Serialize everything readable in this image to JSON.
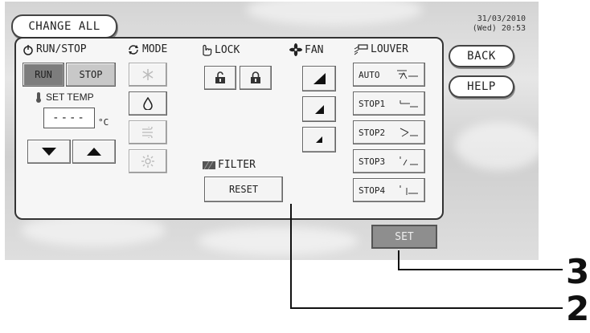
{
  "header": {
    "change_all": "CHANGE ALL",
    "date": "31/03/2010",
    "day_time": "(Wed) 20:53"
  },
  "side_buttons": {
    "back": "BACK",
    "help": "HELP"
  },
  "run_stop": {
    "label": "RUN/STOP",
    "run": "RUN",
    "stop": "STOP",
    "set_temp_label": "SET TEMP",
    "temp_value": "----",
    "temp_unit": "°C"
  },
  "mode": {
    "label": "MODE"
  },
  "lock": {
    "label": "LOCK"
  },
  "fan": {
    "label": "FAN"
  },
  "louver": {
    "label": "LOUVER",
    "options": [
      "AUTO",
      "STOP1",
      "STOP2",
      "STOP3",
      "STOP4"
    ]
  },
  "filter": {
    "label": "FILTER",
    "reset": "RESET"
  },
  "set_button": "SET",
  "callouts": [
    "3",
    "2"
  ]
}
